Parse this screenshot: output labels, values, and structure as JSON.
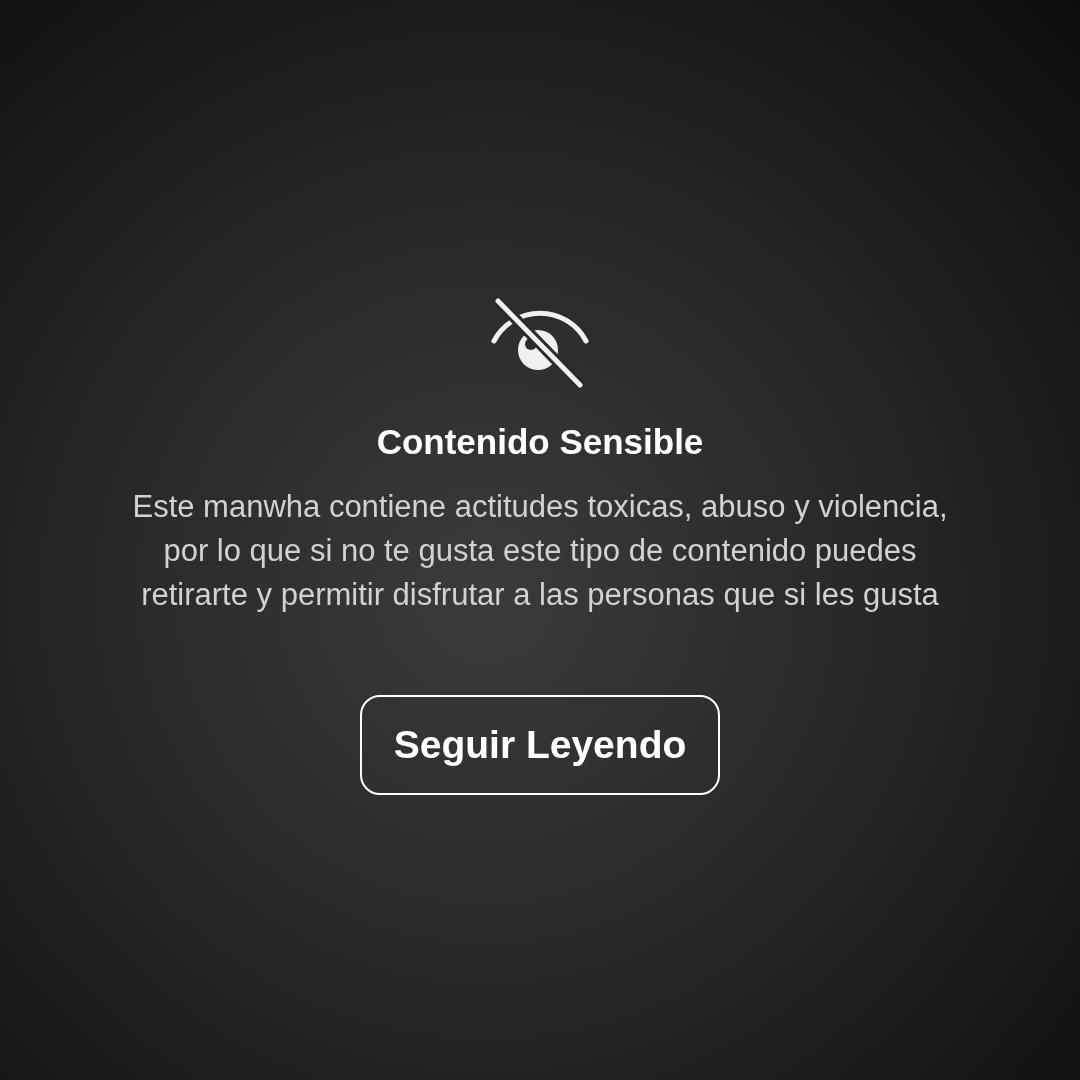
{
  "title": "Contenido Sensible",
  "message": "Este manwha contiene actitudes toxicas, abuso y violencia, por lo que si no te gusta este tipo de contenido puedes retirarte y permitir disfrutar a las personas que si les gusta",
  "button": "Seguir Leyendo"
}
